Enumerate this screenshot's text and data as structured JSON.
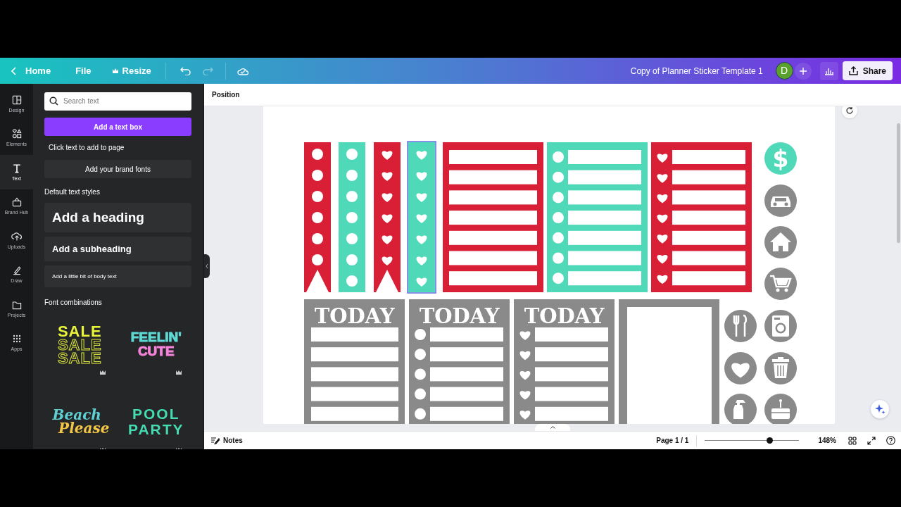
{
  "top_bar": {
    "back_label": "Home",
    "menu": [
      "File",
      "Resize"
    ],
    "document_title": "Copy of Planner Sticker Template 1",
    "avatar_initial": "D",
    "share_label": "Share"
  },
  "rail": [
    {
      "label": "Design",
      "kind": "design",
      "selected": false
    },
    {
      "label": "Elements",
      "kind": "elements",
      "selected": false
    },
    {
      "label": "Text",
      "kind": "text",
      "selected": true
    },
    {
      "label": "Brand Hub",
      "kind": "brand",
      "selected": false
    },
    {
      "label": "Uploads",
      "kind": "uploads",
      "selected": false
    },
    {
      "label": "Draw",
      "kind": "draw",
      "selected": false
    },
    {
      "label": "Projects",
      "kind": "projects",
      "selected": false
    },
    {
      "label": "Apps",
      "kind": "apps",
      "selected": false
    }
  ],
  "panel": {
    "search_placeholder": "Search text",
    "add_button": "Add a text box",
    "hint": "Click text to add to page",
    "brand_fonts": "Add your brand fonts",
    "styles_heading": "Default text styles",
    "styles": [
      {
        "kind": "heading",
        "label": "Add a heading"
      },
      {
        "kind": "subheading",
        "label": "Add a subheading"
      },
      {
        "kind": "body",
        "label": "Add a little bit of body text"
      }
    ],
    "combos_heading": "Font combinations",
    "combos": [
      {
        "kind": "sale",
        "lines": [
          "SALE",
          "SALE",
          "SALE"
        ]
      },
      {
        "kind": "cute",
        "lines": [
          "FEELIN'",
          "CUTE"
        ]
      },
      {
        "kind": "beach",
        "lines": [
          "Beach",
          "Please"
        ]
      },
      {
        "kind": "pool",
        "lines": [
          "POOL",
          "PARTY"
        ]
      }
    ]
  },
  "toolbar": {
    "position_label": "Position"
  },
  "canvas": {
    "strips": [
      {
        "color": "#d81f35",
        "kind": "dot",
        "notched": true,
        "selected": false
      },
      {
        "color": "#4fd9b8",
        "kind": "dot",
        "notched": false,
        "selected": false
      },
      {
        "color": "#d81f35",
        "kind": "heart",
        "notched": true,
        "selected": false
      },
      {
        "color": "#4fd9b8",
        "kind": "heart",
        "notched": false,
        "selected": true
      }
    ],
    "lists": [
      {
        "color": "#d81f35",
        "kind": "plain"
      },
      {
        "color": "#4fd9b8",
        "kind": "dot"
      },
      {
        "color": "#d81f35",
        "kind": "heart"
      }
    ],
    "today": [
      {
        "title": "TODAY",
        "kind": "plain"
      },
      {
        "title": "TODAY",
        "kind": "dot"
      },
      {
        "title": "TODAY",
        "kind": "heart"
      }
    ],
    "dollar_symbol": "$"
  },
  "bottom_bar": {
    "notes_label": "Notes",
    "page_label": "Page 1 / 1",
    "zoom": {
      "level": 0.69
    },
    "zoom_label": "148%"
  }
}
